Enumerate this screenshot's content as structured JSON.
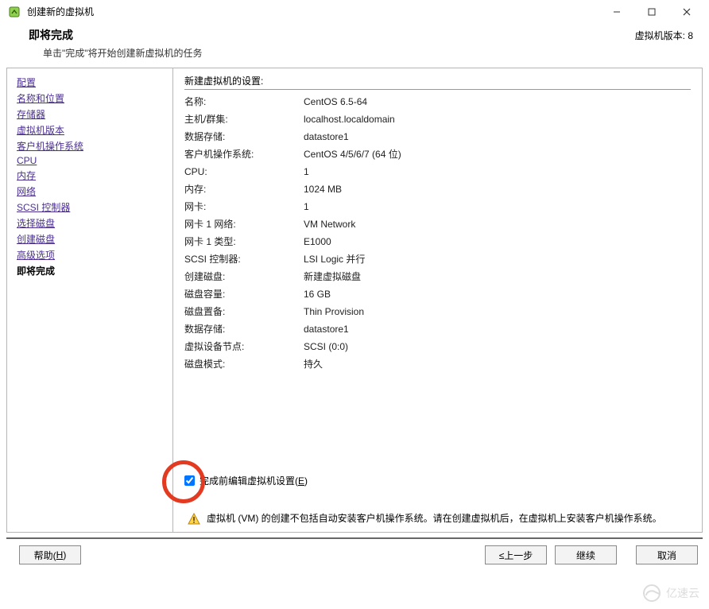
{
  "window": {
    "title": "创建新的虚拟机",
    "minimize": "─",
    "maximize": "□",
    "close": "✕"
  },
  "header": {
    "title": "即将完成",
    "subtitle": "单击\"完成\"将开始创建新虚拟机的任务",
    "version_label": "虚拟机版本: 8"
  },
  "sidebar": {
    "items": [
      "配置",
      "名称和位置",
      "存储器",
      "虚拟机版本",
      "客户机操作系统",
      "CPU",
      "内存",
      "网络",
      "SCSI 控制器",
      "选择磁盘",
      "创建磁盘",
      "高级选项"
    ],
    "current": "即将完成"
  },
  "main": {
    "section_title": "新建虚拟机的设置:",
    "rows": [
      {
        "label": "名称:",
        "value": "CentOS 6.5-64"
      },
      {
        "label": "主机/群集:",
        "value": "localhost.localdomain"
      },
      {
        "label": "数据存储:",
        "value": "datastore1"
      },
      {
        "label": "客户机操作系统:",
        "value": "CentOS 4/5/6/7 (64 位)"
      },
      {
        "label": "CPU:",
        "value": "1"
      },
      {
        "label": "内存:",
        "value": "1024 MB"
      },
      {
        "label": "网卡:",
        "value": "1"
      },
      {
        "label": "网卡 1 网络:",
        "value": "VM Network"
      },
      {
        "label": "网卡 1 类型:",
        "value": "E1000"
      },
      {
        "label": "SCSI 控制器:",
        "value": "LSI Logic 并行"
      },
      {
        "label": "创建磁盘:",
        "value": "新建虚拟磁盘"
      },
      {
        "label": "磁盘容量:",
        "value": "16 GB"
      },
      {
        "label": "磁盘置备:",
        "value": "Thin Provision"
      },
      {
        "label": "数据存储:",
        "value": "datastore1"
      },
      {
        "label": "虚拟设备节点:",
        "value": "SCSI (0:0)"
      },
      {
        "label": "磁盘模式:",
        "value": "持久"
      }
    ],
    "edit_checkbox_label_pre": "完成前编辑虚拟机设置(",
    "edit_checkbox_accel": "E",
    "edit_checkbox_label_post": ")",
    "edit_checked": true,
    "info_message": "虚拟机 (VM) 的创建不包括自动安装客户机操作系统。请在创建虚拟机后，在虚拟机上安装客户机操作系统。"
  },
  "footer": {
    "help_pre": "帮助(",
    "help_accel": "H",
    "help_post": ")",
    "back": "≤上一步",
    "next": "继续",
    "cancel": "取消"
  },
  "watermark": "亿速云"
}
